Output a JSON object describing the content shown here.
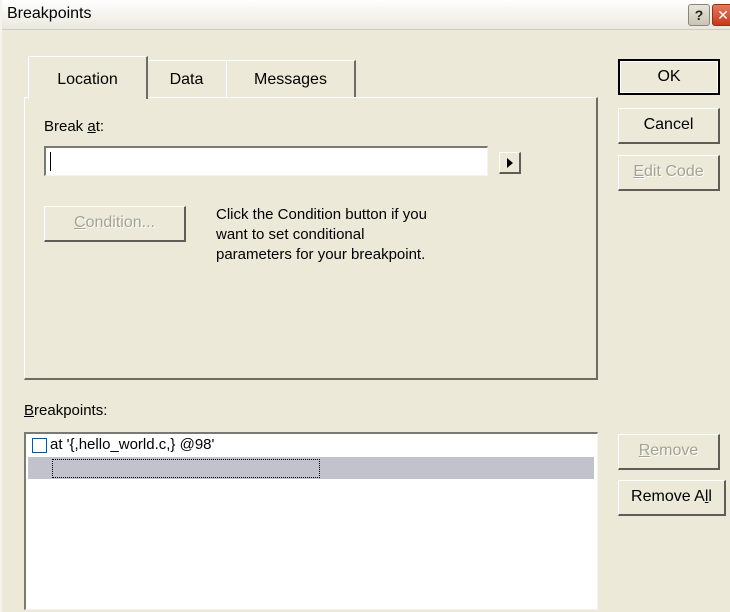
{
  "window": {
    "title": "Breakpoints",
    "help_glyph": "?",
    "close_glyph": "✕"
  },
  "tabs": [
    {
      "label": "Location",
      "active": true
    },
    {
      "label": "Data",
      "active": false
    },
    {
      "label": "Messages",
      "active": false
    }
  ],
  "location": {
    "break_at_pre": "Break ",
    "break_at_mnemonic": "a",
    "break_at_post": "t:",
    "break_at_value": "",
    "condition_mnemonic": "C",
    "condition_rest": "ondition...",
    "help_line1": "Click the Condition button if you",
    "help_line2": "want to set conditional",
    "help_line3": "parameters for your breakpoint."
  },
  "side_buttons": {
    "ok": "OK",
    "cancel": "Cancel",
    "edit_mnemonic": "E",
    "edit_rest": "dit Code",
    "remove_mnemonic": "R",
    "remove_rest": "emove",
    "remove_all_pre": "Remove A",
    "remove_all_mnemonic": "l",
    "remove_all_post": "l"
  },
  "breakpoints": {
    "label_mnemonic": "B",
    "label_rest": "reakpoints:",
    "items": [
      {
        "text": "at '{,hello_world.c,} @98'",
        "checked": false
      }
    ]
  }
}
